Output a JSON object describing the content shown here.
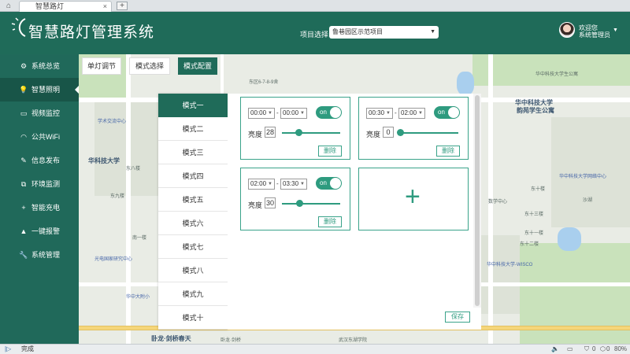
{
  "browser": {
    "tab_title": "智慧路灯",
    "status_text": "完成",
    "status_right": {
      "counter_a": "0",
      "counter_b": "0",
      "zoom": "80%"
    }
  },
  "header": {
    "title": "智慧路灯管理系统",
    "project_label": "项目选择",
    "project_value": "鲁巷园区示范项目",
    "welcome": "欢迎您",
    "user_role": "系统管理员"
  },
  "sidebar": {
    "items": [
      {
        "label": "系统总览",
        "icon": "gear-icon"
      },
      {
        "label": "智慧照明",
        "icon": "bulb-icon"
      },
      {
        "label": "视频监控",
        "icon": "monitor-icon"
      },
      {
        "label": "公共WiFi",
        "icon": "wifi-icon"
      },
      {
        "label": "信息发布",
        "icon": "edit-icon"
      },
      {
        "label": "环境监测",
        "icon": "external-icon"
      },
      {
        "label": "智能充电",
        "icon": "plus-icon"
      },
      {
        "label": "一键报警",
        "icon": "warning-icon"
      },
      {
        "label": "系统管理",
        "icon": "wrench-icon"
      }
    ],
    "active_index": 1
  },
  "toolbar": {
    "single_light": "单灯调节",
    "mode_select": "模式选择",
    "mode_config": "模式配置"
  },
  "modes": [
    "模式一",
    "模式二",
    "模式三",
    "模式四",
    "模式五",
    "模式六",
    "模式七",
    "模式八",
    "模式九",
    "模式十"
  ],
  "schedule_cards": [
    {
      "start": "00:00",
      "end": "00:00",
      "toggle": "on",
      "brightness_label": "亮度",
      "brightness": "28",
      "delete": "删除",
      "level": 0.28
    },
    {
      "start": "00:30",
      "end": "02:00",
      "toggle": "on",
      "brightness_label": "亮度",
      "brightness": "0",
      "delete": "删除",
      "level": 0.0
    },
    {
      "start": "02:00",
      "end": "03:30",
      "toggle": "on",
      "brightness_label": "亮度",
      "brightness": "30",
      "delete": "删除",
      "level": 0.3
    }
  ],
  "add_card_symbol": "+",
  "save_label": "保存",
  "map_labels": {
    "l1": "华中科技大学",
    "l2": "韵苑学生公寓",
    "l3": "东区6-7-8-9舍",
    "l4": "华中科技大学生公寓",
    "l5": "华科技大学",
    "l6": "东八楼",
    "l7": "东九楼",
    "l8": "东十楼",
    "l9": "东十三楼",
    "l10": "沙湖",
    "l11": "卧龙·剑桥春天",
    "l12": "卧龙·剑桥",
    "l13": "武汉东湖学院",
    "l14": "华中科技大学网络中心",
    "l15": "数学中心",
    "l16": "学术交流中心",
    "l17": "东十二楼",
    "l18": "光电国家研究中心",
    "l19": "华中科技大学-WISCO",
    "l20": "东十一楼",
    "l21": "南一楼",
    "l22": "华中大附小"
  }
}
